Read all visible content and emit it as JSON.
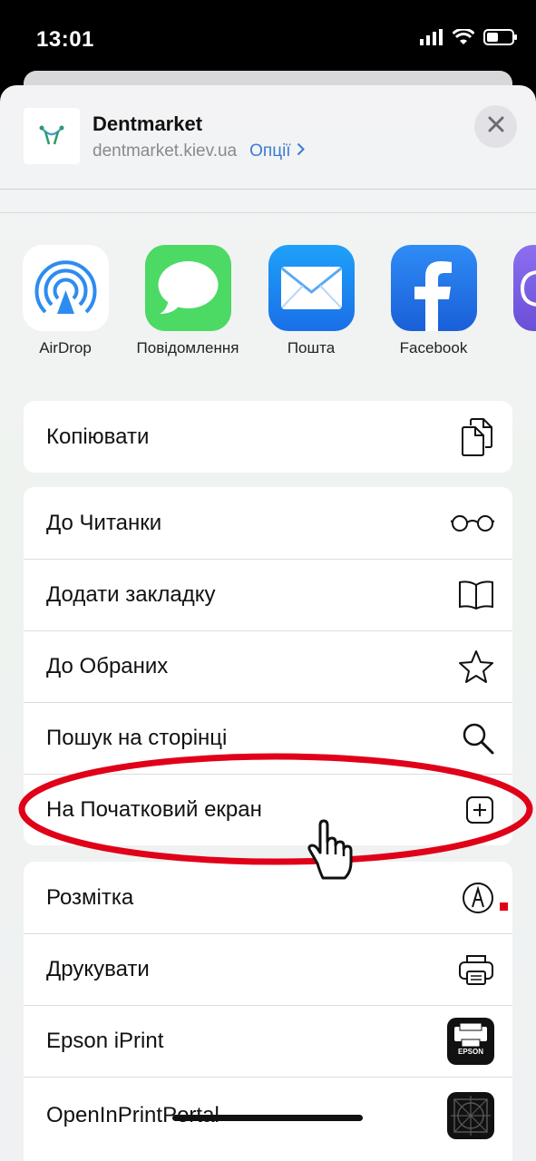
{
  "status": {
    "time": "13:01"
  },
  "header": {
    "title": "Dentmarket",
    "url": "dentmarket.kiev.ua",
    "options_label": "Опції"
  },
  "apps": [
    {
      "label": "AirDrop",
      "icon": "airdrop-icon"
    },
    {
      "label": "Повідомлення",
      "icon": "messages-icon"
    },
    {
      "label": "Пошта",
      "icon": "mail-icon"
    },
    {
      "label": "Facebook",
      "icon": "facebook-icon"
    }
  ],
  "actions": {
    "copy": "Копіювати",
    "reader": "До Читанки",
    "bookmark": "Додати закладку",
    "favorites": "До Обраних",
    "find": "Пошук на сторінці",
    "home_screen": "На Початковий екран",
    "markup": "Розмітка",
    "print": "Друкувати",
    "epson": "Epson iPrint",
    "openinprint": "OpenInPrintPortal"
  },
  "epson_badge": "EPSON",
  "colors": {
    "accent": "#3a7bd5",
    "annotation_red": "#e00018",
    "messages_green": "#4cd964",
    "facebook_blue": "#1877f2"
  }
}
